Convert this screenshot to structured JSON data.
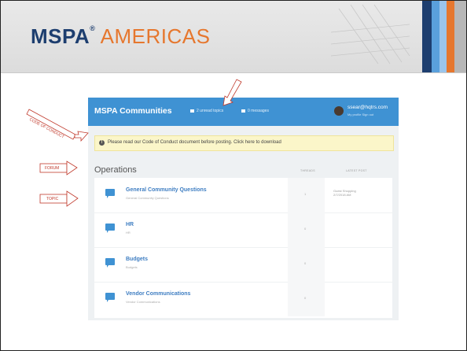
{
  "slide": {
    "title_brand": "MSPA",
    "title_tm": "®",
    "title_sub": "AMERICAS",
    "stripe_colors": [
      "#1d3e6f",
      "#5aa0dc",
      "#9bc5ec",
      "#e6772e",
      "#b7b7b7"
    ]
  },
  "annotations": {
    "code_of_conduct": "CODE OF CONDUCT",
    "forum": "FORUM",
    "topic": "TOPIC"
  },
  "app": {
    "brand": "MSPA Communities",
    "nav": [
      {
        "label": "2 unread topics",
        "icon": "topics-icon"
      },
      {
        "label": "0 messages",
        "icon": "envelope-icon"
      }
    ],
    "user_email": "ssear@hqtrs.com",
    "user_links": "My profile  Sign out",
    "notice": "Please read our Code of Conduct document before posting. Click here to download",
    "forum_title": "Operations",
    "col_threads": "THREADS",
    "col_last_post": "LATEST POST",
    "topics": [
      {
        "name": "General Community Questions",
        "desc": "General Community Questions",
        "threads": "1",
        "last_post_title": "Guest Shopping",
        "last_post_time": "2/7/2018 AM"
      },
      {
        "name": "HR",
        "desc": "HR",
        "threads": "0",
        "last_post_title": "",
        "last_post_time": ""
      },
      {
        "name": "Budgets",
        "desc": "Budgets",
        "threads": "0",
        "last_post_title": "",
        "last_post_time": ""
      },
      {
        "name": "Vendor Communications",
        "desc": "Vendor Communications",
        "threads": "0",
        "last_post_title": "",
        "last_post_time": ""
      }
    ],
    "colors": {
      "accent": "#3f92d3",
      "notice_bg": "#fbf6c9",
      "annotation_red": "#c0392b"
    }
  }
}
